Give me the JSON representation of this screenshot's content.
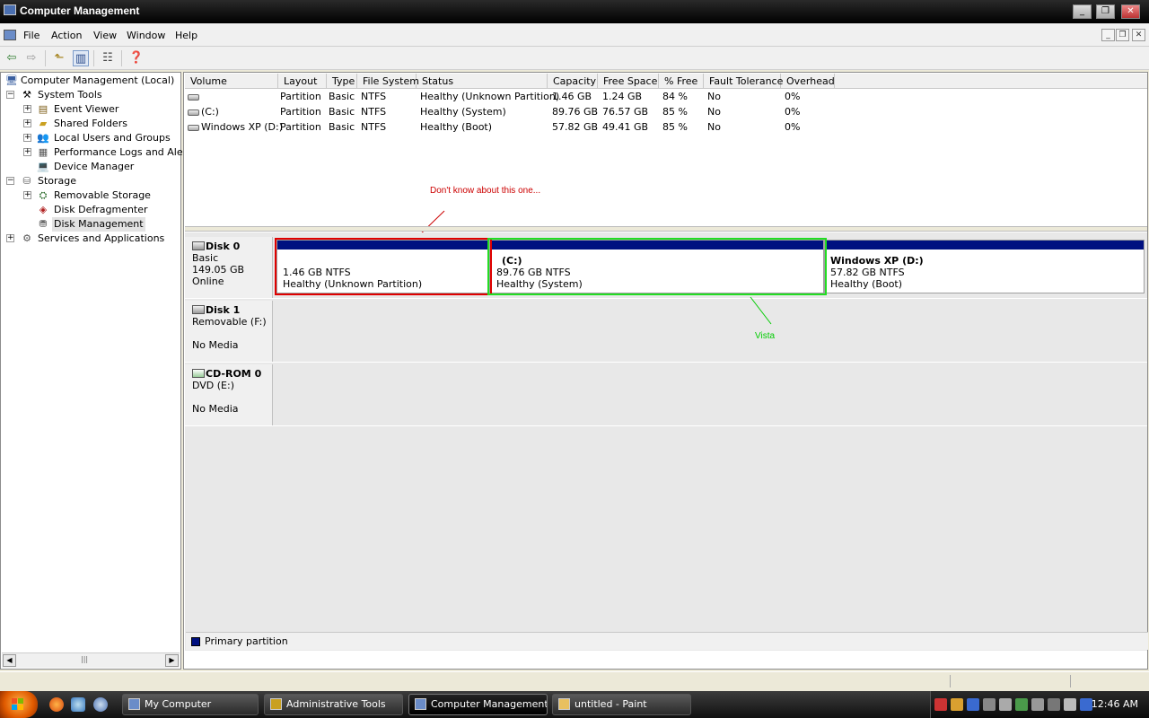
{
  "window": {
    "title": "Computer Management",
    "buttons": {
      "minimize": "_",
      "restore": "❐",
      "close": "✕"
    }
  },
  "menu": {
    "items": [
      "File",
      "Action",
      "View",
      "Window",
      "Help"
    ],
    "mdi": {
      "minimize": "_",
      "restore": "❐",
      "close": "✕"
    }
  },
  "toolbar": {
    "buttons": [
      {
        "icon": "back-arrow-icon",
        "glyph": "⇦"
      },
      {
        "icon": "forward-arrow-icon",
        "glyph": "⇨"
      },
      {
        "icon": "up-folder-icon",
        "glyph": "⬑"
      },
      {
        "icon": "show-hide-tree-icon",
        "glyph": "▥"
      },
      {
        "icon": "properties-icon",
        "glyph": "☷"
      },
      {
        "icon": "help-icon",
        "glyph": "❓"
      }
    ]
  },
  "tree": {
    "root": "Computer Management (Local)",
    "nodes": [
      {
        "label": "System Tools",
        "expander": "−"
      },
      {
        "label": "Event Viewer",
        "expander": "+"
      },
      {
        "label": "Shared Folders",
        "expander": "+"
      },
      {
        "label": "Local Users and Groups",
        "expander": "+"
      },
      {
        "label": "Performance Logs and Alerts",
        "expander": "+"
      },
      {
        "label": "Device Manager",
        "expander": ""
      },
      {
        "label": "Storage",
        "expander": "−"
      },
      {
        "label": "Removable Storage",
        "expander": "+"
      },
      {
        "label": "Disk Defragmenter",
        "expander": ""
      },
      {
        "label": "Disk Management",
        "expander": ""
      },
      {
        "label": "Services and Applications",
        "expander": "+"
      }
    ],
    "scroll": {
      "left": "◀",
      "right": "▶",
      "thumb": "|||"
    }
  },
  "volumes": {
    "columns": [
      "Volume",
      "Layout",
      "Type",
      "File System",
      "Status",
      "Capacity",
      "Free Space",
      "% Free",
      "Fault Tolerance",
      "Overhead"
    ],
    "rows": [
      [
        "",
        "Partition",
        "Basic",
        "NTFS",
        "Healthy (Unknown Partition)",
        "1.46 GB",
        "1.24 GB",
        "84 %",
        "No",
        "0%"
      ],
      [
        "(C:)",
        "Partition",
        "Basic",
        "NTFS",
        "Healthy (System)",
        "89.76 GB",
        "76.57 GB",
        "85 %",
        "No",
        "0%"
      ],
      [
        "Windows XP (D:)",
        "Partition",
        "Basic",
        "NTFS",
        "Healthy (Boot)",
        "57.82 GB",
        "49.41 GB",
        "85 %",
        "No",
        "0%"
      ]
    ]
  },
  "disks": [
    {
      "name": "Disk 0",
      "lines": [
        "Basic",
        "149.05 GB",
        "Online"
      ],
      "partitions": [
        {
          "name": "",
          "size": "1.46 GB NTFS",
          "status": "Healthy (Unknown Partition)"
        },
        {
          "name": "(C:)",
          "size": "89.76 GB NTFS",
          "status": "Healthy (System)"
        },
        {
          "name": "Windows XP  (D:)",
          "size": "57.82 GB NTFS",
          "status": "Healthy (Boot)"
        }
      ]
    },
    {
      "name": "Disk 1",
      "lines": [
        "Removable (F:)",
        "",
        "No Media"
      ]
    },
    {
      "name": "CD-ROM 0",
      "lines": [
        "DVD (E:)",
        "",
        "No Media"
      ]
    }
  ],
  "annotations": {
    "unknown": {
      "text": "Don't know about this one...",
      "color": "#cc0000"
    },
    "vista": {
      "text": "Vista",
      "color": "#00cc00"
    }
  },
  "legend": {
    "label": "Primary partition",
    "color": "#001080"
  },
  "taskbar": {
    "tasks": [
      "My Computer",
      "Administrative Tools",
      "Computer Management",
      "untitled - Paint"
    ],
    "active_task": "Computer Management",
    "clock": "12:46 AM"
  }
}
